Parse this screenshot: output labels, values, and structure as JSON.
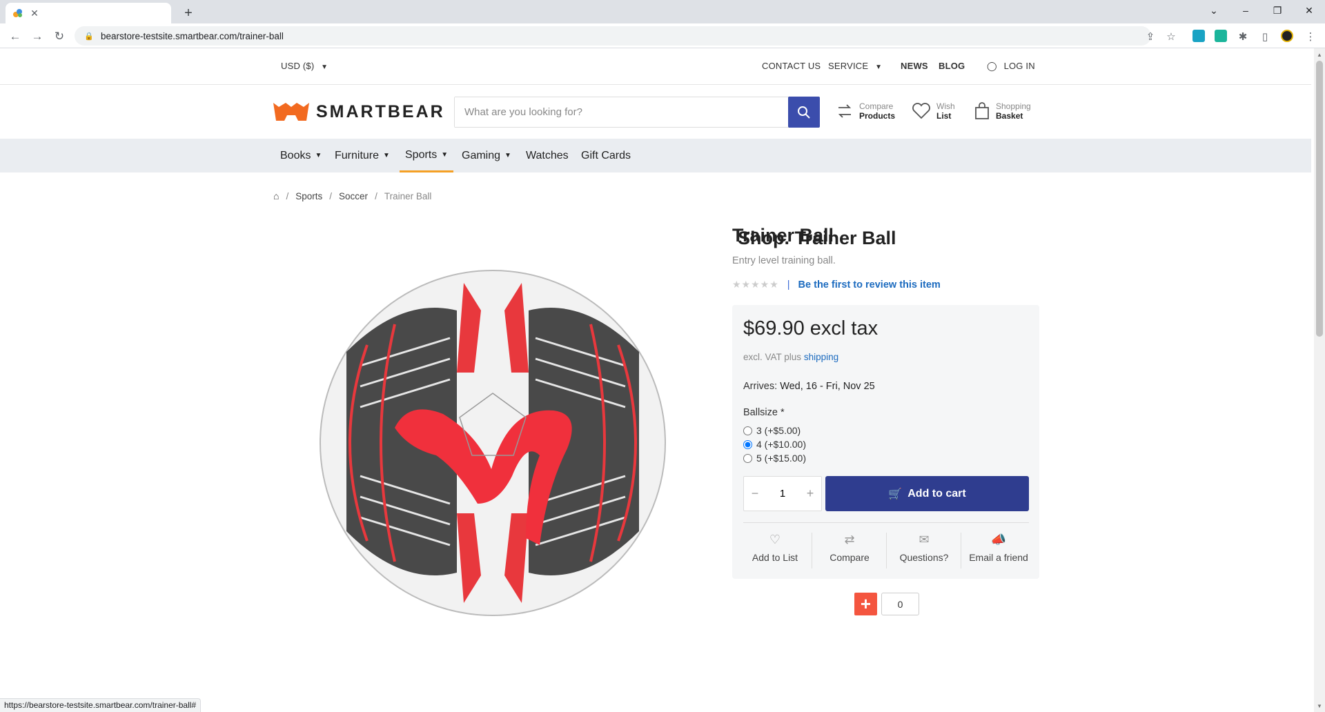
{
  "browser": {
    "tab_title": "Shop. Trainer Ball",
    "url": "bearstore-testsite.smartbear.com/trainer-ball",
    "status_url": "https://bearstore-testsite.smartbear.com/trainer-ball#"
  },
  "topbar": {
    "currency": "USD  ($)",
    "contact": "CONTACT US",
    "service": "SERVICE",
    "news": "NEWS",
    "blog": "BLOG",
    "login": "LOG IN"
  },
  "header": {
    "logo_text": "SMARTBEAR",
    "search_placeholder": "What are you looking for?",
    "compare_small": "Compare",
    "compare_big": "Products",
    "wish_small": "Wish",
    "wish_big": "List",
    "basket_small": "Shopping",
    "basket_big": "Basket"
  },
  "categories": [
    {
      "label": "Books",
      "dropdown": true
    },
    {
      "label": "Furniture",
      "dropdown": true
    },
    {
      "label": "Sports",
      "dropdown": true,
      "active": true
    },
    {
      "label": "Gaming",
      "dropdown": true
    },
    {
      "label": "Watches",
      "dropdown": false
    },
    {
      "label": "Gift Cards",
      "dropdown": false
    }
  ],
  "breadcrumb": [
    "Sports",
    "Soccer",
    "Trainer Ball"
  ],
  "product": {
    "title": "Trainer Ball",
    "short_description": "Entry level training ball.",
    "review_link": "Be the first to review this item",
    "rating": 0,
    "price": "$69.90 excl tax",
    "vat_text": "excl. VAT plus",
    "shipping_link": "shipping",
    "arrives_label": "Arrives:",
    "arrives_value": "Wed, 16 - Fri, Nov 25",
    "attribute_label": "Ballsize *",
    "options": [
      {
        "label": "3 (+$5.00)",
        "selected": false
      },
      {
        "label": "4 (+$10.00)",
        "selected": true
      },
      {
        "label": "5 (+$15.00)",
        "selected": false
      }
    ],
    "quantity": "1",
    "add_to_cart": "Add to cart",
    "actions": [
      "Add to List",
      "Compare",
      "Questions?",
      "Email a friend"
    ]
  },
  "share": {
    "count": "0"
  },
  "colors": {
    "accent_blue": "#3b4dac",
    "cart_button": "#2f3d8f",
    "logo_orange": "#f26a20",
    "active_underline": "#f5a025",
    "share_red": "#f4553f",
    "link": "#1c6bbf"
  }
}
